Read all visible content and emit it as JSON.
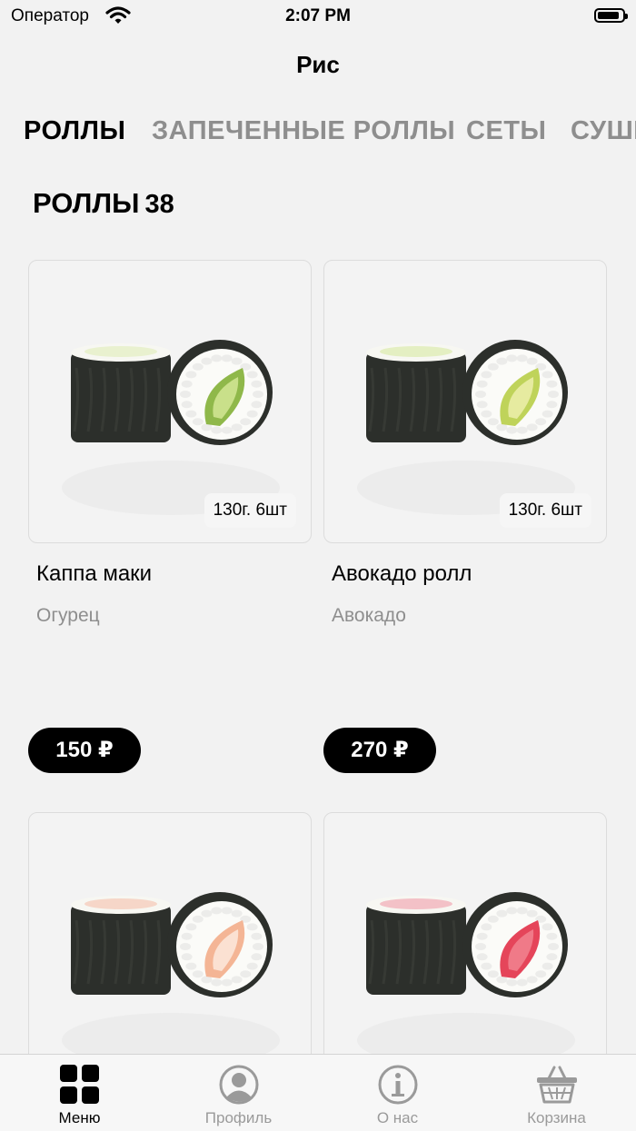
{
  "status_bar": {
    "carrier": "Оператор",
    "time": "2:07 PM",
    "battery_level": 0.9
  },
  "header": {
    "title": "Рис"
  },
  "categories": [
    "РОЛЛЫ",
    "ЗАПЕЧЕННЫЕ РОЛЛЫ",
    "СЕТЫ",
    "СУШИ"
  ],
  "section": {
    "title": "РОЛЛЫ",
    "count": "38"
  },
  "products": [
    {
      "name": "Каппа маки",
      "description": "Огурец",
      "weight": "130г. 6шт",
      "price": "150 ₽",
      "filling": "cucumber"
    },
    {
      "name": "Авокадо ролл",
      "description": "Авокадо",
      "weight": "130г. 6шт",
      "price": "270 ₽",
      "filling": "avocado"
    },
    {
      "name": "",
      "description": "",
      "weight": "",
      "price": "",
      "filling": "shrimp"
    },
    {
      "name": "",
      "description": "",
      "weight": "",
      "price": "",
      "filling": "tuna"
    }
  ],
  "tabbar": [
    {
      "label": "Меню",
      "icon": "grid-icon",
      "active": true
    },
    {
      "label": "Профиль",
      "icon": "profile-icon",
      "active": false
    },
    {
      "label": "О нас",
      "icon": "info-icon",
      "active": false
    },
    {
      "label": "Корзина",
      "icon": "basket-icon",
      "active": false
    }
  ],
  "colors": {
    "accent": "#000000",
    "inactive": "#8e8e8e",
    "background": "#f2f2f2"
  }
}
